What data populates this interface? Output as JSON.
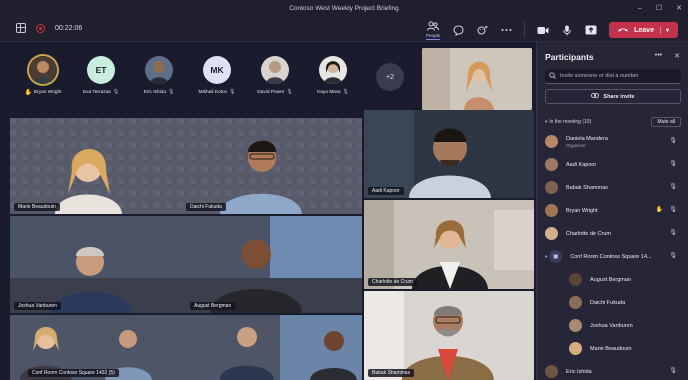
{
  "window": {
    "title": "Contoso West Weekly Project Briefing",
    "controls": [
      "–",
      "☐",
      "✕"
    ]
  },
  "toolbar": {
    "timer": "00:22:06",
    "people_label": "People",
    "leave_label": "Leave",
    "icons": [
      "layout-grid-icon",
      "record-icon",
      "people-icon",
      "chat-icon",
      "reactions-icon",
      "more-icon",
      "camera-icon",
      "mic-icon",
      "share-tray-icon",
      "phone-icon"
    ]
  },
  "stage": {
    "avatars": [
      {
        "name": "Bryan Wright",
        "initials": "",
        "color": "#b38d62",
        "hand": true,
        "mic": false,
        "active": true
      },
      {
        "name": "Eva Terrazas",
        "initials": "ET",
        "color": "#c9eedf",
        "hand": false,
        "mic": true,
        "active": false
      },
      {
        "name": "Eric Ishida",
        "initials": "",
        "color": "#8d6a52",
        "hand": false,
        "mic": true,
        "active": false
      },
      {
        "name": "Mikhail Kotov",
        "initials": "MK",
        "color": "#dfe0f4",
        "hand": false,
        "mic": true,
        "active": false
      },
      {
        "name": "David Power",
        "initials": "",
        "color": "#b69a82",
        "hand": false,
        "mic": true,
        "active": false
      },
      {
        "name": "Kayo Miwa",
        "initials": "",
        "color": "#c7b39c",
        "hand": false,
        "mic": true,
        "active": false
      }
    ],
    "overflow": "+2",
    "tiles": [
      {
        "id": "room-main",
        "labels": [
          "Marie Beaudouin",
          "Daichi Fukuda"
        ]
      },
      {
        "id": "aadi",
        "labels": [
          "Aadi Kapoor"
        ]
      },
      {
        "id": "room-mid",
        "labels": [
          "Joshua Vanburen",
          "August Bergman"
        ]
      },
      {
        "id": "charlotte",
        "labels": [
          "Charlotte de Crum"
        ]
      },
      {
        "id": "room-bottom",
        "labels": [
          "Conf Room Contoso Square 1432 (5)"
        ]
      },
      {
        "id": "babak",
        "labels": [
          "Babak Shammas"
        ]
      }
    ]
  },
  "panel": {
    "title": "Participants",
    "invite_placeholder": "Invite someone or dial a number",
    "share_invite": "Share invite",
    "section_label": "In the meeting (10)",
    "mute_all": "Mute all",
    "participants": [
      {
        "name": "Daniela Mandera",
        "role": "Organizer",
        "color": "#b9866a",
        "sub": false,
        "hand": false
      },
      {
        "name": "Aadi Kapoor",
        "role": "",
        "color": "#9c7a62",
        "sub": false,
        "hand": false
      },
      {
        "name": "Babak Shammas",
        "role": "",
        "color": "#7d6350",
        "sub": false,
        "hand": false
      },
      {
        "name": "Bryan Wright",
        "role": "",
        "color": "#a07454",
        "sub": false,
        "hand": true
      },
      {
        "name": "Charlotte de Crum",
        "role": "",
        "color": "#d1b08a",
        "sub": false,
        "hand": false
      },
      {
        "name": "Conf Room Contoso Square 14...",
        "role": "",
        "color": "#3b3b58",
        "sub": false,
        "hand": false,
        "room": true
      },
      {
        "name": "August Bergman",
        "role": "",
        "color": "#5a4436",
        "sub": true,
        "hand": false
      },
      {
        "name": "Daichi Fukuda",
        "role": "",
        "color": "#8a6d58",
        "sub": true,
        "hand": false
      },
      {
        "name": "Joshua Vanburen",
        "role": "",
        "color": "#a88a74",
        "sub": true,
        "hand": false
      },
      {
        "name": "Marie Beaudouin",
        "role": "",
        "color": "#d6ad7e",
        "sub": true,
        "hand": false
      },
      {
        "name": "Eric Ishida",
        "role": "",
        "color": "#6e5543",
        "sub": false,
        "hand": false
      }
    ]
  },
  "colors": {
    "accent": "#7f85f5",
    "leave": "#c4314b",
    "hand": "#f2c14e",
    "panel_bg": "#262637",
    "stage_bg": "#1b1b2e"
  }
}
